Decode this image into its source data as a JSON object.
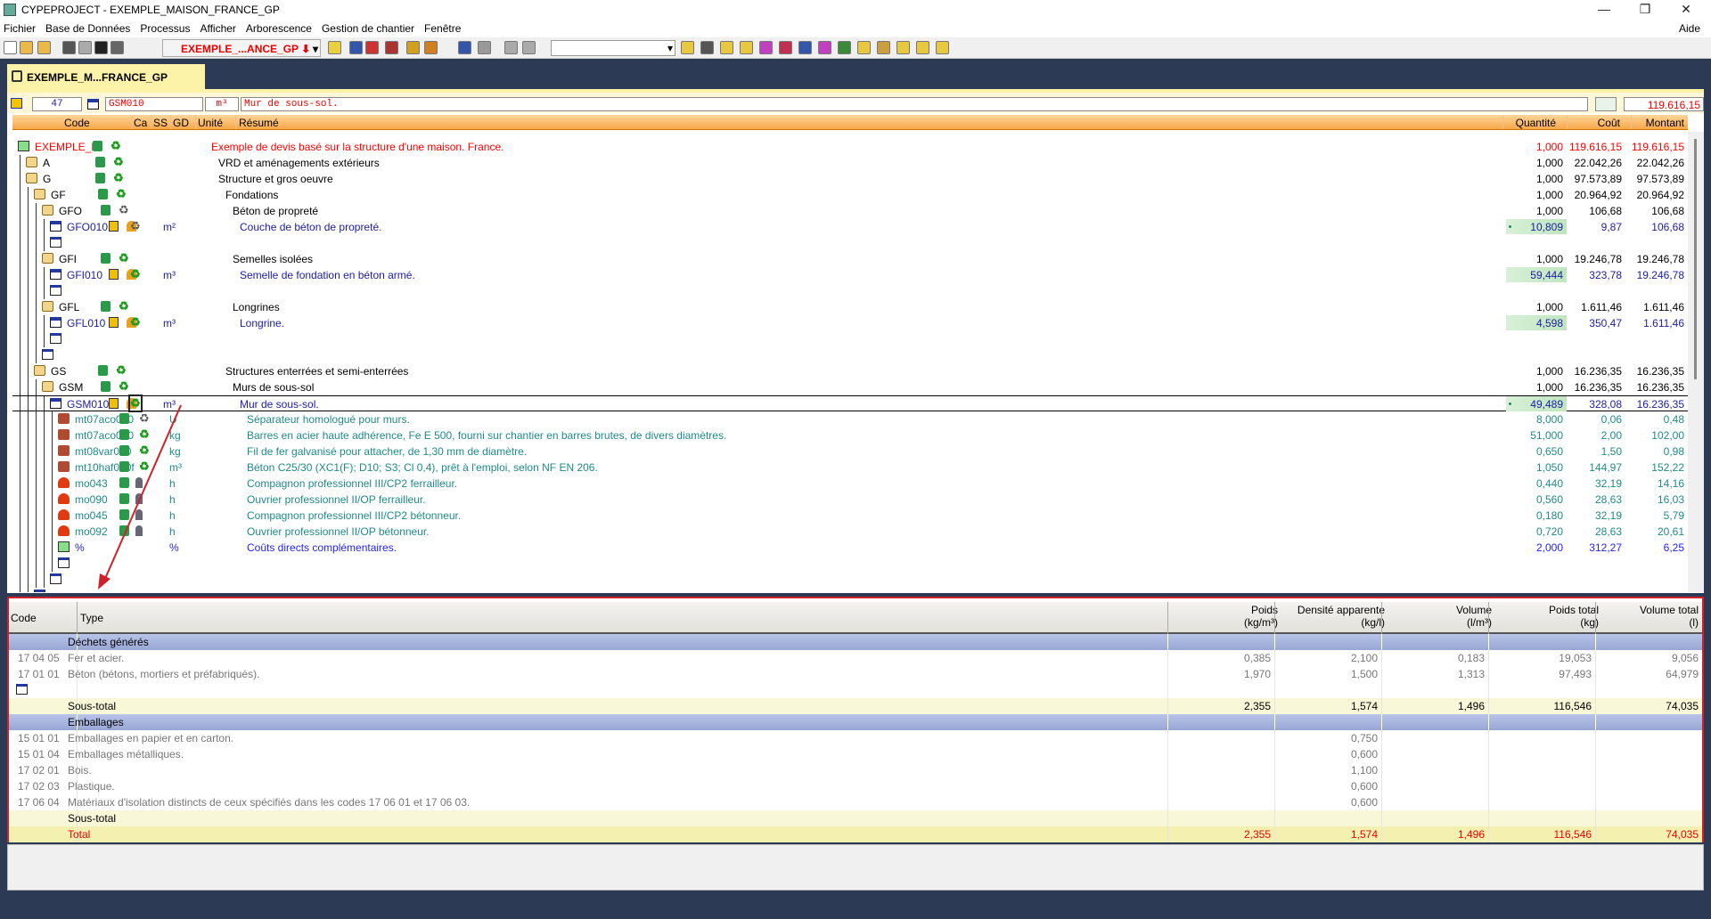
{
  "window": {
    "title": "CYPEPROJECT - EXEMPLE_MAISON_FRANCE_GP",
    "controls": [
      "—",
      "❐",
      "✕"
    ]
  },
  "menu": [
    "Fichier",
    "Base de Données",
    "Processus",
    "Afficher",
    "Arborescence",
    "Gestion de chantier",
    "Fenêtre"
  ],
  "help": "Aide",
  "toolbar": {
    "project": "EXEMPLE_...ANCE_GP",
    "blank_select": ""
  },
  "tab": {
    "label": "EXEMPLE_M...FRANCE_GP"
  },
  "input_row": {
    "number": "47",
    "code": "GSM010",
    "unit": "m³",
    "summary": "Mur de sous-sol.",
    "total": "119.616,15"
  },
  "columns": {
    "code": "Code",
    "ca": "Ca",
    "ss": "SS",
    "gd": "GD",
    "unit": "Unité",
    "summary": "Résumé",
    "qty": "Quantité",
    "cost": "Coût",
    "amount": "Montant"
  },
  "colors": {
    "root": "#ff0000",
    "chapter": "#000000",
    "unit_item": "#1c1ca0",
    "resource": "#1f8a8a",
    "percent": "#1f1fff",
    "highlight_frame": "#d0202a"
  },
  "tree": [
    {
      "lvl": 0,
      "icon": "budget",
      "code": "EXEMPLE_M",
      "ca": "scroll",
      "gd": "recycle",
      "unit": "",
      "summary": "Exemple de devis basé sur la structure d'une maison. France.",
      "qty": "1,000",
      "cost": "119.616,15",
      "amount": "119.616,15",
      "kind": "root"
    },
    {
      "lvl": 1,
      "icon": "folder",
      "code": "A",
      "ca": "scroll",
      "gd": "recycle",
      "unit": "",
      "summary": "VRD et aménagements extérieurs",
      "qty": "1,000",
      "cost": "22.042,26",
      "amount": "22.042,26",
      "kind": "chapter"
    },
    {
      "lvl": 1,
      "icon": "folder",
      "code": "G",
      "ca": "scroll",
      "gd": "recycle",
      "unit": "",
      "summary": "Structure et gros oeuvre",
      "qty": "1,000",
      "cost": "97.573,89",
      "amount": "97.573,89",
      "kind": "chapter"
    },
    {
      "lvl": 2,
      "icon": "folder",
      "code": "GF",
      "ca": "scroll",
      "gd": "recycle",
      "unit": "",
      "summary": "Fondations",
      "qty": "1,000",
      "cost": "20.964,92",
      "amount": "20.964,92",
      "kind": "chapter"
    },
    {
      "lvl": 3,
      "icon": "folder",
      "code": "GFO",
      "ca": "scroll",
      "gd": "recycle-gray",
      "unit": "",
      "summary": "Béton de propreté",
      "qty": "1,000",
      "cost": "106,68",
      "amount": "106,68",
      "kind": "chapter"
    },
    {
      "lvl": 4,
      "icon": "unit",
      "code": "GFO010",
      "ca": "price",
      "ss": "cone",
      "gd": "recycle-gray",
      "unit": "m²",
      "summary": "Couche de béton de propreté.",
      "qty": "10,809",
      "qbg": true,
      "dot": true,
      "cost": "9,87",
      "amount": "106,68",
      "kind": "item"
    },
    {
      "lvl": 4,
      "icon": "add"
    },
    {
      "lvl": 3,
      "icon": "folder",
      "code": "GFI",
      "ca": "scroll",
      "gd": "recycle",
      "unit": "",
      "summary": "Semelles isolées",
      "qty": "1,000",
      "cost": "19.246,78",
      "amount": "19.246,78",
      "kind": "chapter"
    },
    {
      "lvl": 4,
      "icon": "unit",
      "code": "GFI010",
      "ca": "price",
      "ss": "cone",
      "gd": "recycle",
      "unit": "m³",
      "summary": "Semelle de fondation en béton armé.",
      "qty": "59,444",
      "qbg": true,
      "cost": "323,78",
      "amount": "19.246,78",
      "kind": "item"
    },
    {
      "lvl": 4,
      "icon": "add"
    },
    {
      "lvl": 3,
      "icon": "folder",
      "code": "GFL",
      "ca": "scroll",
      "gd": "recycle",
      "unit": "",
      "summary": "Longrines",
      "qty": "1,000",
      "cost": "1.611,46",
      "amount": "1.611,46",
      "kind": "chapter"
    },
    {
      "lvl": 4,
      "icon": "unit",
      "code": "GFL010",
      "ca": "price",
      "ss": "cone",
      "gd": "recycle",
      "unit": "m³",
      "summary": "Longrine.",
      "qty": "4,598",
      "qbg": true,
      "cost": "350,47",
      "amount": "1.611,46",
      "kind": "item"
    },
    {
      "lvl": 4,
      "icon": "add"
    },
    {
      "lvl": 3,
      "icon": "add"
    },
    {
      "lvl": 2,
      "icon": "folder",
      "code": "GS",
      "ca": "scroll",
      "gd": "recycle",
      "unit": "",
      "summary": "Structures enterrées et semi-enterrées",
      "qty": "1,000",
      "cost": "16.236,35",
      "amount": "16.236,35",
      "kind": "chapter"
    },
    {
      "lvl": 3,
      "icon": "folder",
      "code": "GSM",
      "ca": "scroll",
      "gd": "recycle",
      "unit": "",
      "summary": "Murs de sous-sol",
      "qty": "1,000",
      "cost": "16.236,35",
      "amount": "16.236,35",
      "kind": "chapter"
    },
    {
      "lvl": 4,
      "icon": "unit",
      "code": "GSM010",
      "ca": "price",
      "ss": "cone",
      "gd": "recycle",
      "unit": "m³",
      "summary": "Mur de sous-sol.",
      "qty": "49,489",
      "qbg": true,
      "dot": true,
      "cost": "328,08",
      "amount": "16.236,35",
      "kind": "item",
      "selected": true
    },
    {
      "lvl": 5,
      "icon": "brick",
      "code": "mt07aco020",
      "ca": "scroll",
      "gd": "recycle-gray",
      "unit": "U",
      "summary": "Séparateur homologué pour murs.",
      "qty": "8,000",
      "cost": "0,06",
      "amount": "0,48",
      "kind": "res"
    },
    {
      "lvl": 5,
      "icon": "brick",
      "code": "mt07aco050",
      "ca": "scroll",
      "gd": "recycle",
      "unit": "kg",
      "summary": "Barres en acier haute adhérence, Fe E 500, fourni sur chantier en barres brutes, de divers diamètres.",
      "qty": "51,000",
      "cost": "2,00",
      "amount": "102,00",
      "kind": "res"
    },
    {
      "lvl": 5,
      "icon": "brick",
      "code": "mt08var050",
      "ca": "scroll",
      "gd": "recycle",
      "unit": "kg",
      "summary": "Fil de fer galvanisé pour attacher, de 1,30 mm de diamètre.",
      "qty": "0,650",
      "cost": "1,50",
      "amount": "0,98",
      "kind": "res"
    },
    {
      "lvl": 5,
      "icon": "brick",
      "code": "mt10haf030f",
      "ca": "scroll",
      "gd": "recycle",
      "unit": "m³",
      "summary": "Béton C25/30 (XC1(F); D10; S3; Cl 0,4), prêt à l'emploi, selon NF EN 206.",
      "qty": "1,050",
      "cost": "144,97",
      "amount": "152,22",
      "kind": "res"
    },
    {
      "lvl": 5,
      "icon": "hat",
      "code": "mo043",
      "ca": "scroll",
      "ss": "worker",
      "unit": "h",
      "summary": "Compagnon professionnel III/CP2 ferrailleur.",
      "qty": "0,440",
      "cost": "32,19",
      "amount": "14,16",
      "kind": "res"
    },
    {
      "lvl": 5,
      "icon": "hat",
      "code": "mo090",
      "ca": "scroll",
      "ss": "worker",
      "unit": "h",
      "summary": "Ouvrier professionnel II/OP ferrailleur.",
      "qty": "0,560",
      "cost": "28,63",
      "amount": "16,03",
      "kind": "res"
    },
    {
      "lvl": 5,
      "icon": "hat",
      "code": "mo045",
      "ca": "scroll",
      "ss": "worker",
      "unit": "h",
      "summary": "Compagnon professionnel III/CP2 bétonneur.",
      "qty": "0,180",
      "cost": "32,19",
      "amount": "5,79",
      "kind": "res"
    },
    {
      "lvl": 5,
      "icon": "hat",
      "code": "mo092",
      "ca": "scroll",
      "ss": "worker",
      "unit": "h",
      "summary": "Ouvrier professionnel II/OP bétonneur.",
      "qty": "0,720",
      "cost": "28,63",
      "amount": "20,61",
      "kind": "res"
    },
    {
      "lvl": 5,
      "icon": "pct",
      "code": "%",
      "unit": "%",
      "summary": "Coûts directs complémentaires.",
      "qty": "2,000",
      "cost": "312,27",
      "amount": "6,25",
      "kind": "pct"
    },
    {
      "lvl": 5,
      "icon": "add"
    },
    {
      "lvl": 4,
      "icon": "add"
    },
    {
      "lvl": 2,
      "icon": "add"
    }
  ],
  "waste": {
    "columns": {
      "code": "Code",
      "type": "Type",
      "poids": [
        "Poids",
        "(kg/m³)"
      ],
      "densite": [
        "Densité apparente",
        "(kg/l)"
      ],
      "volume": [
        "Volume",
        "(l/m³)"
      ],
      "poids_total": [
        "Poids total",
        "(kg)"
      ],
      "volume_total": [
        "Volume total",
        "(l)"
      ]
    },
    "rows": [
      {
        "kind": "group",
        "type": "Déchets générés"
      },
      {
        "kind": "row",
        "code": "17 04 05",
        "type": "Fer et acier.",
        "poids": "0,385",
        "densite": "2,100",
        "volume": "0,183",
        "poids_total": "19,053",
        "volume_total": "9,056"
      },
      {
        "kind": "row",
        "code": "17 01 01",
        "type": "Béton (bétons, mortiers et préfabriqués).",
        "poids": "1,970",
        "densite": "1,500",
        "volume": "1,313",
        "poids_total": "97,493",
        "volume_total": "64,979"
      },
      {
        "kind": "add"
      },
      {
        "kind": "sub",
        "type": "Sous-total",
        "poids": "2,355",
        "densite": "1,574",
        "volume": "1,496",
        "poids_total": "116,546",
        "volume_total": "74,035"
      },
      {
        "kind": "group",
        "type": "Emballages"
      },
      {
        "kind": "row",
        "code": "15 01 01",
        "type": "Emballages en papier et en carton.",
        "densite": "0,750"
      },
      {
        "kind": "row",
        "code": "15 01 04",
        "type": "Emballages métalliques.",
        "densite": "0,600"
      },
      {
        "kind": "row",
        "code": "17 02 01",
        "type": "Bois.",
        "densite": "1,100"
      },
      {
        "kind": "row",
        "code": "17 02 03",
        "type": "Plastique.",
        "densite": "0,600"
      },
      {
        "kind": "row",
        "code": "17 06 04",
        "type": "Matériaux d'isolation distincts de ceux spécifiés dans les codes 17 06 01 et 17 06 03.",
        "densite": "0,600"
      },
      {
        "kind": "sub",
        "type": "Sous-total"
      },
      {
        "kind": "total",
        "type": "Total",
        "poids": "2,355",
        "densite": "1,574",
        "volume": "1,496",
        "poids_total": "116,546",
        "volume_total": "74,035"
      }
    ]
  }
}
